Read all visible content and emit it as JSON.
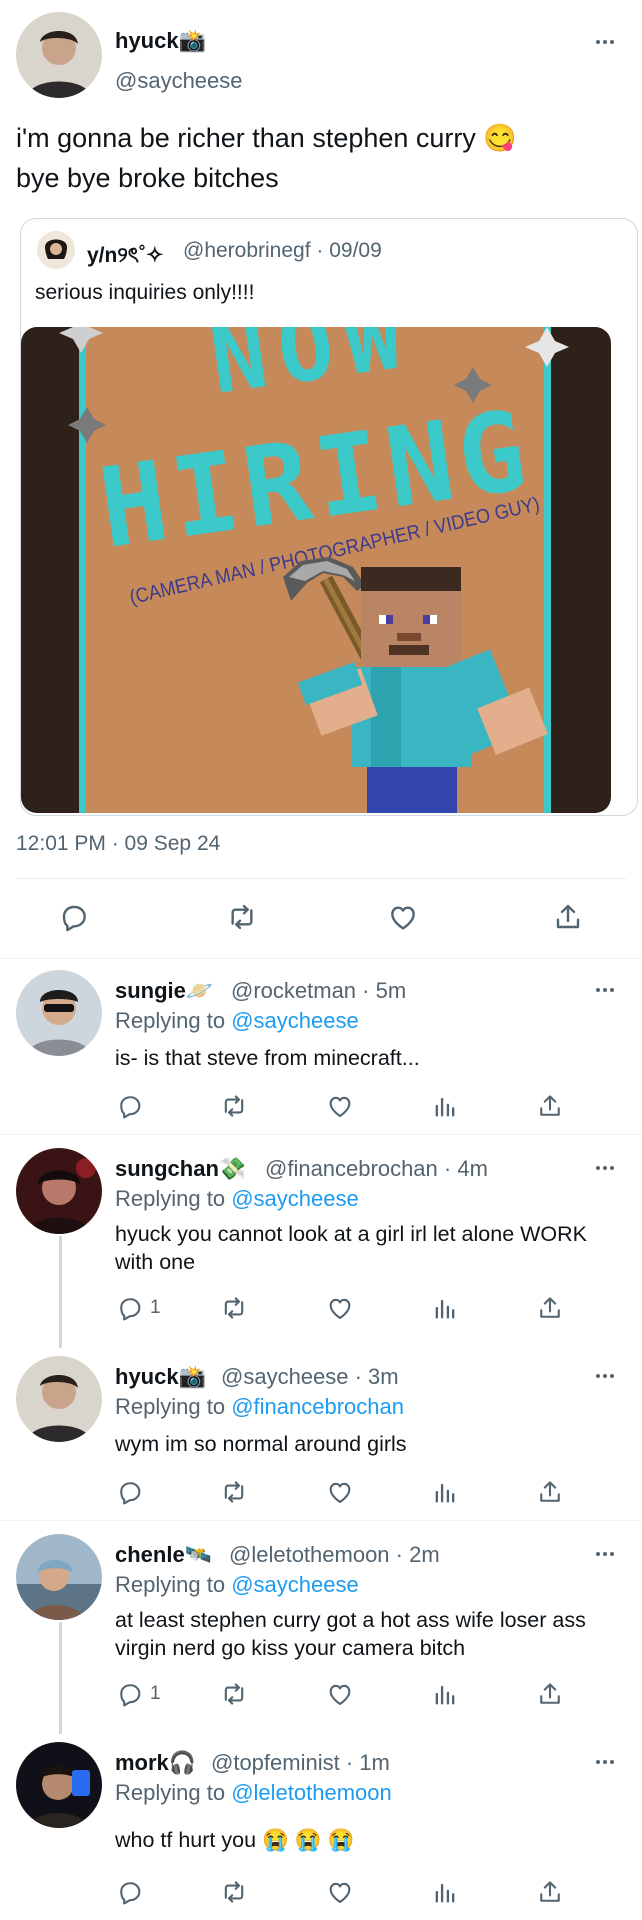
{
  "main_tweet": {
    "name": "hyuck📸",
    "handle": "@saycheese",
    "text_line1": "i'm gonna be richer than stephen curry 😋",
    "text_line2": "bye bye broke bitches",
    "timestamp": "12:01 PM · 09 Sep 24",
    "quote": {
      "name": "y/n୨ৎ˚✧",
      "handle_date": "@herobrinegf · 09/09",
      "text": "serious inquiries only!!!!",
      "image": {
        "title_line1": "NOW",
        "title_line2": "HIRING",
        "subtitle": "(CAMERA MAN / PHOTOGRAPHER / VIDEO GUY)",
        "bg_color": "#c68a5a",
        "title_color": "#3cc9c9",
        "subtitle_color": "#3d3a8c"
      }
    }
  },
  "replies": [
    {
      "name": "sungie🪐",
      "meta": "@rocketman · 5m",
      "replying_label": "Replying to ",
      "replying_to": "@saycheese",
      "text": "is- is that steve from minecraft...",
      "reply_count": ""
    },
    {
      "name": "sungchan💸",
      "meta": "@financebrochan · 4m",
      "replying_label": "Replying to ",
      "replying_to": "@saycheese",
      "text": "hyuck you cannot look at a girl irl let alone WORK with one",
      "reply_count": "1"
    },
    {
      "name": "hyuck📸",
      "meta": "@saycheese · 3m",
      "replying_label": "Replying to ",
      "replying_to": "@financebrochan",
      "text": "wym im so normal around girls",
      "reply_count": ""
    },
    {
      "name": "chenle🛰️",
      "meta": "@leletothemoon · 2m",
      "replying_label": "Replying to ",
      "replying_to": "@saycheese",
      "text": "at least stephen curry got a hot ass wife loser ass virgin nerd go kiss your camera bitch",
      "reply_count": "1"
    },
    {
      "name": "mork🎧",
      "meta": "@topfeminist · 1m",
      "replying_label": "Replying to ",
      "replying_to": "@leletothemoon",
      "text": "who tf hurt you 😭 😭 😭",
      "reply_count": ""
    }
  ],
  "colors": {
    "link": "#1d9bf0",
    "muted": "#536471"
  }
}
